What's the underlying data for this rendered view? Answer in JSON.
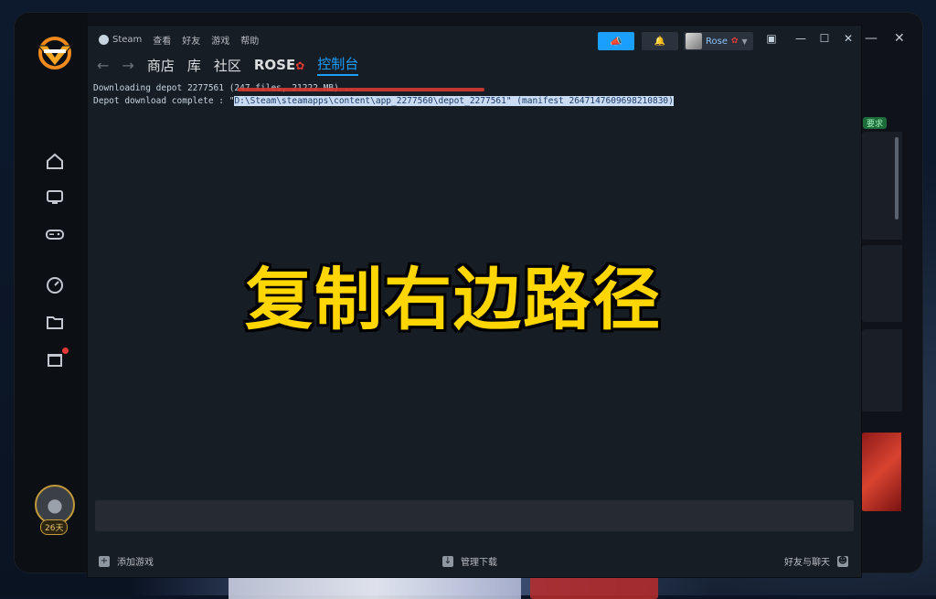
{
  "menu": {
    "steam": "Steam",
    "view": "查看",
    "friends": "好友",
    "games": "游戏",
    "help": "帮助"
  },
  "user": {
    "name": "Rose"
  },
  "nav": {
    "store": "商店",
    "library": "库",
    "community": "社区",
    "profile": "ROSE",
    "console": "控制台"
  },
  "console": {
    "line1": "Downloading depot 2277561 (247 files, 21222 MB) ...",
    "line2_prefix": "Depot download complete : \"",
    "line2_path": "D:\\Steam\\steamapps\\content\\app_2277560\\depot_2277561\" (manifest 2647147609698210830)"
  },
  "bottombar": {
    "add_game": "添加游戏",
    "manage_downloads": "管理下载",
    "friends_chat": "好友与聊天"
  },
  "launcher": {
    "days": "26天",
    "side_tag": "要求"
  },
  "caption": "复制右边路径",
  "colors": {
    "accent": "#1a9fff",
    "caption": "#ffd600",
    "highlight": "#c9dcf3"
  }
}
